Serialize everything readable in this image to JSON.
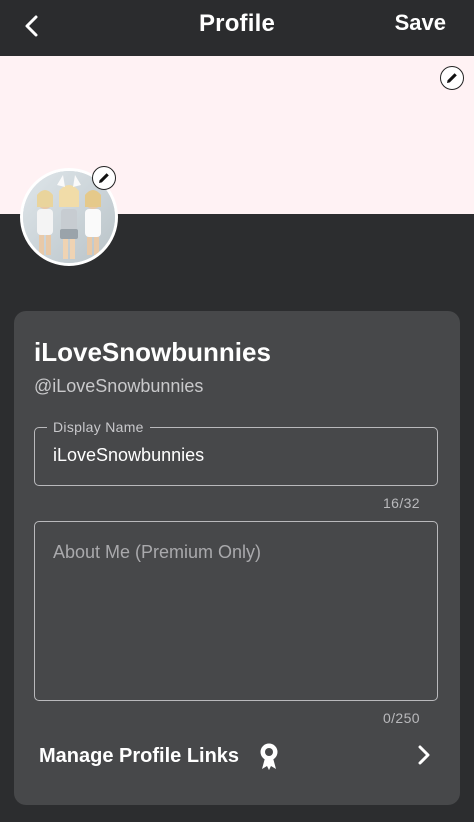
{
  "header": {
    "title": "Profile",
    "save_label": "Save",
    "back_icon": "back-arrow-icon"
  },
  "banner": {
    "background_color": "#fff2f4",
    "edit_icon": "pencil-icon"
  },
  "avatar": {
    "edit_icon": "pencil-icon"
  },
  "profile": {
    "display_name": "iLoveSnowbunnies",
    "handle": "@iLoveSnowbunnies"
  },
  "form": {
    "display_name_label": "Display Name",
    "display_name_value": "iLoveSnowbunnies",
    "display_name_counter": "16/32",
    "about_placeholder": "About Me (Premium Only)",
    "about_counter": "0/250"
  },
  "links": {
    "label": "Manage Profile Links",
    "badge_icon": "premium-badge-icon",
    "chevron_icon": "chevron-right-icon"
  },
  "colors": {
    "background": "#2c2d2f",
    "card": "#47484a",
    "text": "#ffffff",
    "muted": "#b9b9bc"
  }
}
